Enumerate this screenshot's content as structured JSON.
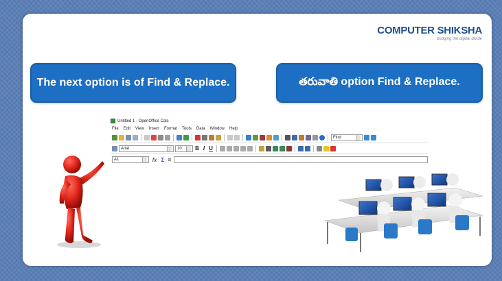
{
  "logo": {
    "brand": "COMPUTER SHIKSHA",
    "tagline": "bridging the digital divide"
  },
  "callouts": {
    "english": "The next option is of Find & Replace.",
    "telugu": "తరువాతి option Find & Replace."
  },
  "openoffice": {
    "window_title": "Untitled 1 - OpenOffice Calc",
    "menu": [
      "File",
      "Edit",
      "View",
      "Insert",
      "Format",
      "Tools",
      "Data",
      "Window",
      "Help"
    ],
    "find_box_value": "Find",
    "font_name": "Arial",
    "font_size": "10",
    "bold_label": "B",
    "italic_label": "I",
    "underline_label": "U",
    "cell_ref": "A1",
    "fx_label": "fx",
    "sum_label": "Σ",
    "equals_label": "="
  },
  "colors": {
    "callout_bg": "#1c6fc2",
    "slide_frame": "#5b7fb7",
    "logo": "#1f4e8c"
  }
}
